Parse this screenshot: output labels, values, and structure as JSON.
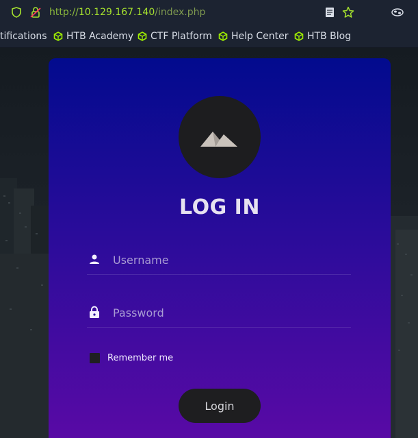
{
  "browser": {
    "url_scheme": "http://",
    "url_host": "10.129.167.140",
    "url_path": "/index.php"
  },
  "bookmarks": [
    {
      "label": "tifications"
    },
    {
      "label": "HTB Academy"
    },
    {
      "label": "CTF Platform"
    },
    {
      "label": "Help Center"
    },
    {
      "label": "HTB Blog"
    }
  ],
  "login": {
    "title": "LOG IN",
    "username_placeholder": "Username",
    "password_placeholder": "Password",
    "remember_label": "Remember me",
    "submit_label": "Login"
  },
  "icons": {
    "shield": "shield-icon",
    "lock_warning": "insecure-lock-icon",
    "reader": "reader-view-icon",
    "star": "bookmark-star-icon",
    "extension": "extension-icon",
    "bookmark_cube": "cube-icon",
    "logo": "mountain-icon",
    "user": "user-icon",
    "lock": "lock-icon"
  },
  "colors": {
    "card_top": "#020b8e",
    "card_bottom": "#5b0aa6",
    "url_green": "#a6e22e",
    "bookmark_icon_green": "#9fef00"
  }
}
